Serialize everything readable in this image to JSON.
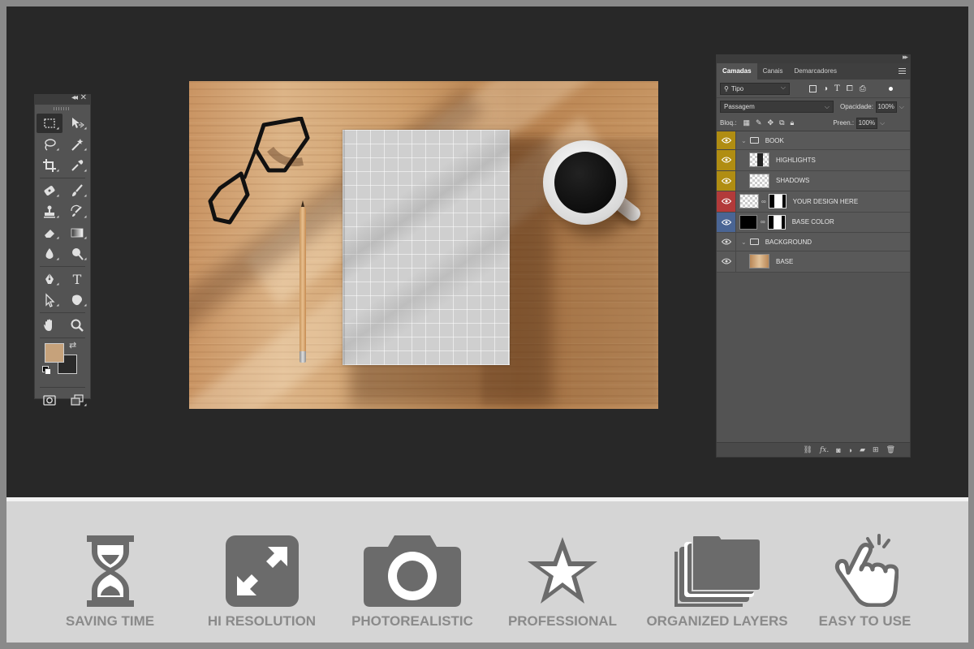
{
  "colors": {
    "workspace": "#282828",
    "panel": "#535353",
    "foreground_swatch": "#c6a27b",
    "background_swatch": "#2a2a2a",
    "tag_yellow": "#b08d12",
    "tag_red": "#b23a3a",
    "tag_blue": "#4a6594",
    "feature_icon": "#6b6b6b",
    "feature_text": "#8a8a8a"
  },
  "tools_panel": {
    "collapse": "◂◂",
    "close": "✕",
    "tools": [
      [
        "marquee-icon",
        "move-icon"
      ],
      [
        "lasso-icon",
        "magic-wand-icon"
      ],
      [
        "crop-icon",
        "eyedropper-icon"
      ],
      [
        "healing-icon",
        "brush-icon"
      ],
      [
        "stamp-icon",
        "history-brush-icon"
      ],
      [
        "eraser-icon",
        "gradient-icon"
      ],
      [
        "blur-icon",
        "dodge-icon"
      ],
      [
        "pen-icon",
        "type-icon"
      ],
      [
        "path-select-icon",
        "shape-icon"
      ],
      [
        "hand-icon",
        "zoom-icon"
      ]
    ],
    "type_glyph": "T"
  },
  "layers_panel": {
    "tabs": [
      "Camadas",
      "Canais",
      "Demarcadores"
    ],
    "active_tab": "Camadas",
    "filter": {
      "icon": "search-icon",
      "label": "Tipo"
    },
    "blend_mode": "Passagem",
    "opacity_label": "Opacidade:",
    "opacity_value": "100%",
    "lock_label": "Bloq.:",
    "fill_label": "Preen.:",
    "fill_value": "100%",
    "layers": [
      {
        "name": "BOOK",
        "kind": "group",
        "tag": "yellow"
      },
      {
        "name": "HIGHLIGHTS",
        "kind": "layer",
        "tag": "yellow"
      },
      {
        "name": "SHADOWS",
        "kind": "layer",
        "tag": "yellow"
      },
      {
        "name": "YOUR DESIGN HERE",
        "kind": "smart-object",
        "tag": "red"
      },
      {
        "name": "BASE COLOR",
        "kind": "fill",
        "tag": "blue"
      },
      {
        "name": "BACKGROUND",
        "kind": "group",
        "tag": "none"
      },
      {
        "name": "BASE",
        "kind": "image",
        "tag": "none"
      }
    ],
    "footer_icons": [
      "link-icon",
      "fx-icon",
      "mask-icon",
      "adjustment-icon",
      "folder-icon",
      "new-layer-icon",
      "trash-icon"
    ],
    "footer_fx": "fx."
  },
  "features": [
    {
      "icon": "hourglass-icon",
      "label": "SAVING TIME"
    },
    {
      "icon": "expand-icon",
      "label": "HI RESOLUTION"
    },
    {
      "icon": "camera-icon",
      "label": "PHOTOREALISTIC"
    },
    {
      "icon": "star-icon",
      "label": "PROFESSIONAL"
    },
    {
      "icon": "layers-icon",
      "label": "ORGANIZED LAYERS"
    },
    {
      "icon": "hand-pointer-icon",
      "label": "EASY TO USE"
    }
  ]
}
